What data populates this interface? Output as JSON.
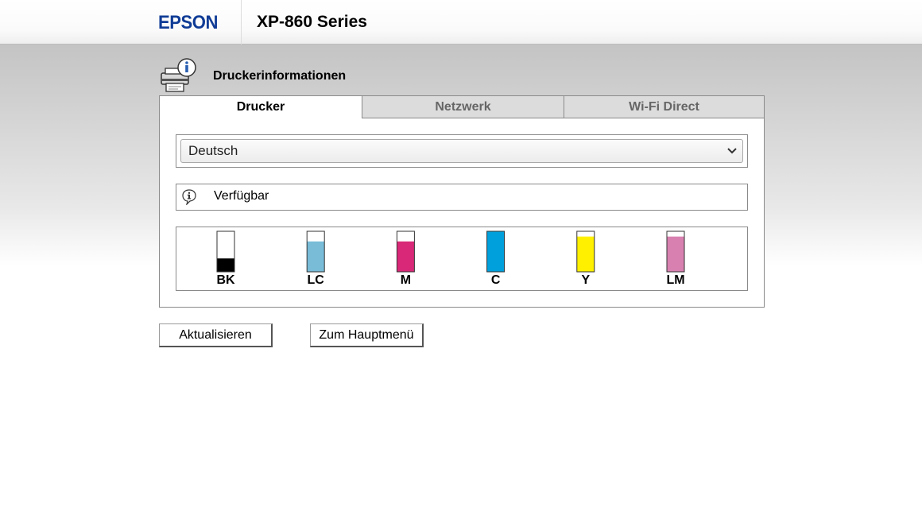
{
  "header": {
    "logo": "EPSON",
    "model": "XP-860 Series",
    "logo_color": "#103c96"
  },
  "page": {
    "title": "Druckerinformationen",
    "title_icon": "printer-info-icon"
  },
  "tabs": [
    {
      "label": "Drucker",
      "active": true
    },
    {
      "label": "Netzwerk",
      "active": false
    },
    {
      "label": "Wi-Fi Direct",
      "active": false
    }
  ],
  "language_select": {
    "value": "Deutsch",
    "icon": "chevron-down-icon"
  },
  "status": {
    "icon": "info-icon",
    "text": "Verfügbar"
  },
  "inks": [
    {
      "code": "BK",
      "color": "#000000",
      "level": 0.33
    },
    {
      "code": "LC",
      "color": "#78bcd8",
      "level": 0.75
    },
    {
      "code": "M",
      "color": "#d82877",
      "level": 0.75
    },
    {
      "code": "C",
      "color": "#00a0dc",
      "level": 1.0
    },
    {
      "code": "Y",
      "color": "#fff000",
      "level": 0.87
    },
    {
      "code": "LM",
      "color": "#d881b0",
      "level": 0.87
    }
  ],
  "buttons": {
    "refresh": "Aktualisieren",
    "main_menu": "Zum Hauptmenü"
  }
}
